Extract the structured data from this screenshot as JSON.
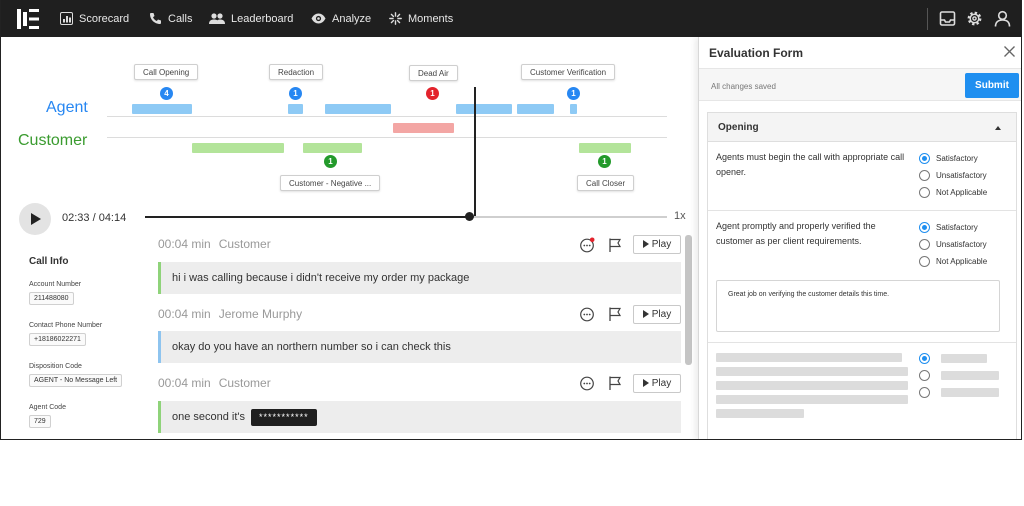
{
  "nav": {
    "items": [
      {
        "label": "Scorecard",
        "icon": "scorecard-icon"
      },
      {
        "label": "Calls",
        "icon": "phone-icon"
      },
      {
        "label": "Leaderboard",
        "icon": "people-icon"
      },
      {
        "label": "Analyze",
        "icon": "eye-icon"
      },
      {
        "label": "Moments",
        "icon": "moments-icon"
      }
    ],
    "right_icons": [
      "inbox-icon",
      "gear-icon",
      "user-icon"
    ]
  },
  "timeline": {
    "agent_label": "Agent",
    "customer_label": "Customer",
    "colors": {
      "agent": "#8ecaf5",
      "customer": "#b3e49a",
      "dead_air": "#f3a6a4",
      "agent_text": "#2787f2",
      "customer_text": "#3a9b2f"
    },
    "moments_top": [
      {
        "label": "Call Opening",
        "count": "4",
        "color": "blue"
      },
      {
        "label": "Redaction",
        "count": "1",
        "color": "blue"
      },
      {
        "label": "Dead Air",
        "count": "1",
        "color": "red"
      },
      {
        "label": "Customer Verification",
        "count": "1",
        "color": "blue"
      }
    ],
    "moments_bottom": [
      {
        "label": "Customer - Negative ...",
        "count": "1",
        "color": "green"
      },
      {
        "label": "Call Closer",
        "count": "1",
        "color": "green"
      }
    ]
  },
  "player": {
    "time": "02:33 / 04:14",
    "progress": 0.62,
    "speed": "1x"
  },
  "call_info": {
    "title": "Call Info",
    "fields": [
      {
        "label": "Account Number",
        "value": "211488080"
      },
      {
        "label": "Contact Phone Number",
        "value": "+18186022271"
      },
      {
        "label": "Disposition Code",
        "value": "AGENT - No Message Left"
      },
      {
        "label": "Agent Code",
        "value": "729"
      }
    ]
  },
  "transcript": [
    {
      "duration": "00:04 min",
      "speaker": "Customer",
      "text": "hi i was calling because i didn't receive my order my package",
      "redacted": "",
      "play_label": "Play"
    },
    {
      "duration": "00:04 min",
      "speaker": "Jerome Murphy",
      "text": "okay do you have an northern number so i can check this",
      "redacted": "",
      "play_label": "Play"
    },
    {
      "duration": "00:04 min",
      "speaker": "Customer",
      "text": "one second it's",
      "redacted": "***********",
      "play_label": "Play"
    }
  ],
  "evaluation": {
    "title": "Evaluation Form",
    "saved_status": "All changes saved",
    "submit_label": "Submit",
    "section_title": "Opening",
    "questions": [
      {
        "text": "Agents must begin the call with appropriate call opener.",
        "options": [
          "Satisfactory",
          "Unsatisfactory",
          "Not Applicable"
        ],
        "selected": 0
      },
      {
        "text": "Agent promptly and properly verified the customer as per client requirements.",
        "options": [
          "Satisfactory",
          "Unsatisfactory",
          "Not Applicable"
        ],
        "selected": 0
      }
    ],
    "comment": "Great job on verifying the customer details this time."
  }
}
